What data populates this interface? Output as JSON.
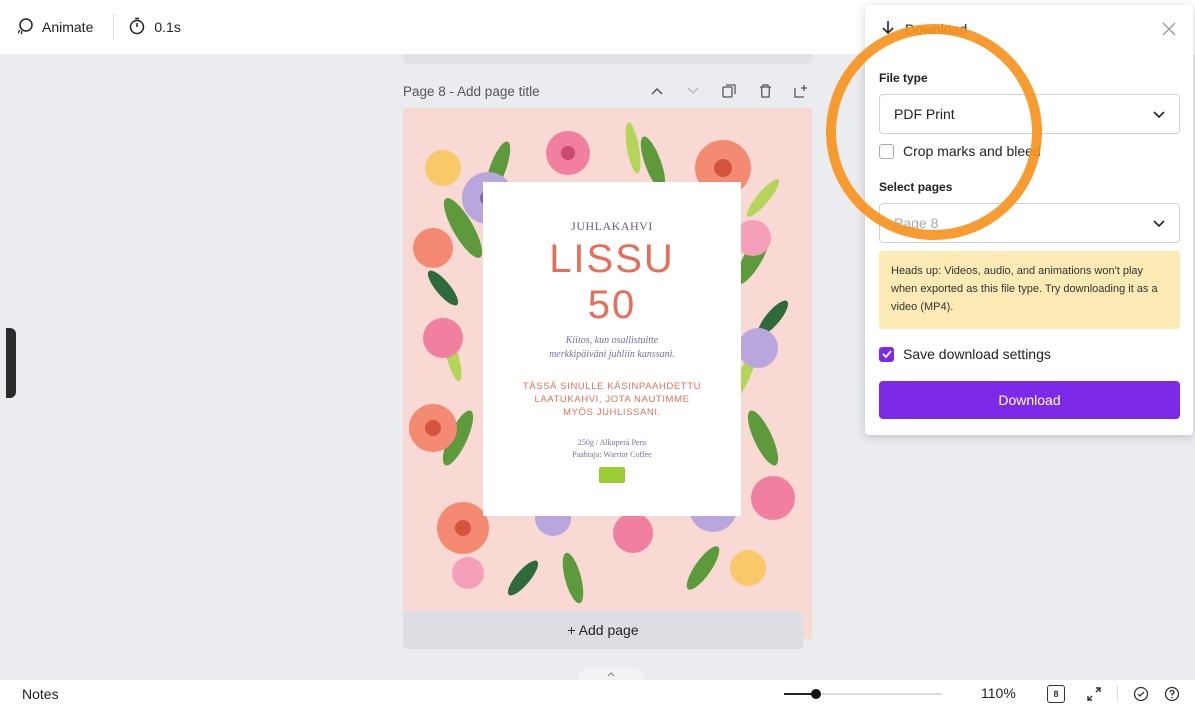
{
  "toolbar": {
    "animate_label": "Animate",
    "timer_value": "0.1s"
  },
  "page": {
    "title": "Page 8 - Add page title",
    "add_page_label": "+ Add page"
  },
  "design": {
    "eyebrow": "JUHLAKAHVI",
    "title_line1": "LISSU",
    "title_line2": "50",
    "sub_line1": "Kiitos, kun osallistuitte",
    "sub_line2": "merkkipäivänі juhliin kanssani.",
    "caps_line1": "TÄSSÄ SINULLE KÄSINPAAHDETTU",
    "caps_line2": "LAATUKAHVI, JOTA NAUTIMME",
    "caps_line3": "MYÖS JUHLISSANI.",
    "small_line1": "250g / Alkuperä Peru",
    "small_line2": "Paahtaja: Warrior Coffee"
  },
  "bottom": {
    "notes_label": "Notes",
    "zoom_value": "110%",
    "zoom_fraction": 0.2,
    "page_count": "8"
  },
  "download_panel": {
    "title": "Download",
    "file_type_label": "File type",
    "file_type_value": "PDF Print",
    "crop_label": "Crop marks and bleed",
    "crop_checked": false,
    "select_pages_label": "Select pages",
    "select_pages_value": "Page 8",
    "notice": "Heads up: Videos, audio, and animations won't play when exported as this file type. Try downloading it as a video (MP4).",
    "save_settings_label": "Save download settings",
    "save_settings_checked": true,
    "download_button": "Download"
  },
  "colors": {
    "accent": "#7d2ae8",
    "highlight_ring": "#f7931e",
    "notice_bg": "#feeab5",
    "page_bg": "#f8d9d4"
  }
}
